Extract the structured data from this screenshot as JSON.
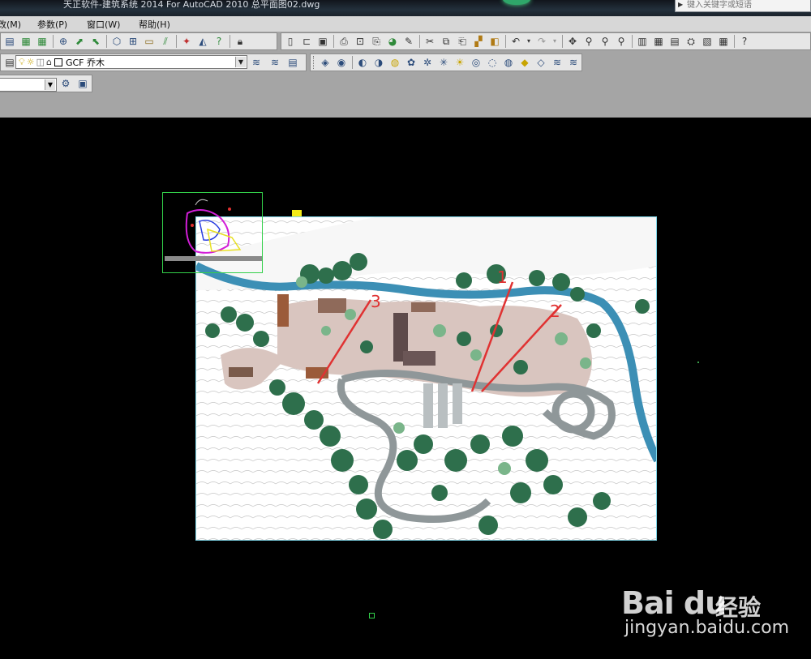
{
  "window": {
    "title": "天正软件-建筑系统 2014  For AutoCAD 2010      总平面图02.dwg",
    "search_placeholder": "键入关键字或短语"
  },
  "menu": {
    "items": [
      "改(M)",
      "参数(P)",
      "窗口(W)",
      "帮助(H)"
    ]
  },
  "toolbars": {
    "layer_current": "GCF  乔木"
  },
  "plan_labels": [
    "1",
    "2",
    "3"
  ],
  "watermark": {
    "brand": "Bai du",
    "brand_cn": "经验",
    "url": "jingyan.baidu.com"
  },
  "colors": {
    "canvas": "#000000",
    "viewport_frame": "#33d04a",
    "plan_frame": "#7fd6e8",
    "annotation": "#e03232"
  }
}
